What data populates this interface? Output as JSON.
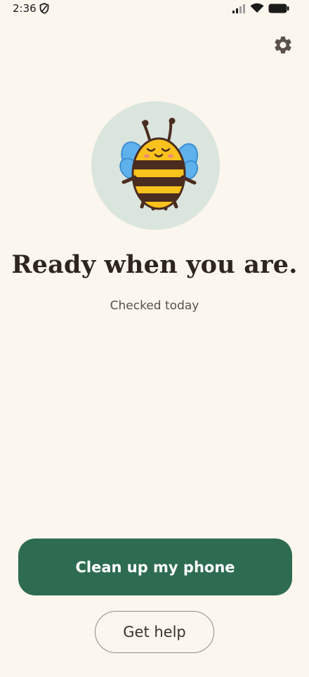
{
  "status_bar": {
    "time": "2:36"
  },
  "header": {
    "settings_icon": "gear-icon"
  },
  "mascot": {
    "icon": "bee-mascot",
    "circle_color": "#dae5dd"
  },
  "main": {
    "headline": "Ready when you are.",
    "subtext": "Checked today"
  },
  "actions": {
    "primary_label": "Clean up my phone",
    "secondary_label": "Get help"
  },
  "colors": {
    "background": "#fbf6ee",
    "primary": "#2e6c51",
    "headline": "#2e2520"
  }
}
